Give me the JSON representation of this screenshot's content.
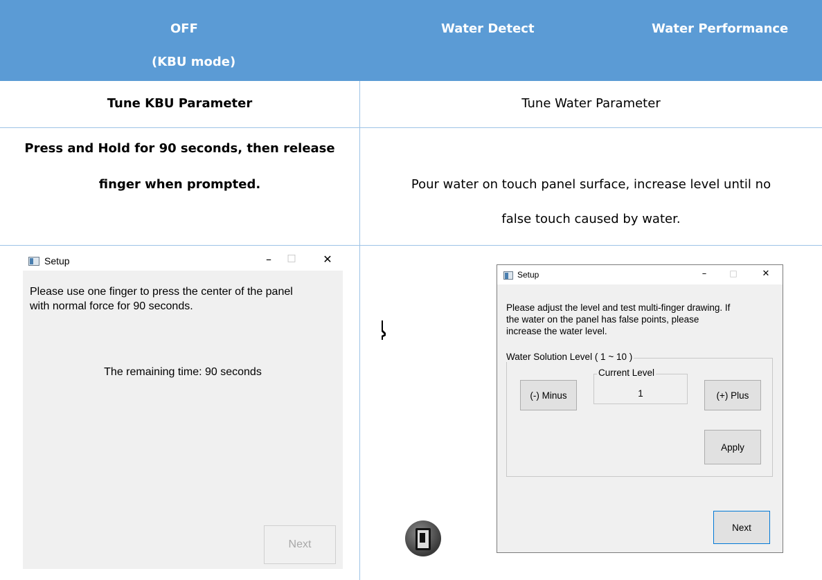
{
  "header": {
    "col1_line1": "OFF",
    "col1_line2": "(KBU mode)",
    "col2": "Water Detect",
    "col3": "Water Performance"
  },
  "row1": {
    "left": "Tune KBU Parameter",
    "right": "Tune Water Parameter"
  },
  "row2": {
    "left_line1": "Press and Hold for 90 seconds, then release",
    "left_line2": "finger when prompted.",
    "right_line1": "Pour water on touch panel surface, increase level until no",
    "right_line2": "false touch caused by water."
  },
  "dialog_kbu": {
    "title": "Setup",
    "message_line1": "Please use one finger to press the center of the panel",
    "message_line2": "with normal force for 90 seconds.",
    "remaining": "The remaining time: 90 seconds",
    "next_label": "Next",
    "minimize": "–",
    "maximize": "□",
    "close": "✕"
  },
  "dialog_water": {
    "title": "Setup",
    "message_line1": "Please adjust the level and test multi-finger drawing. If",
    "message_line2": "the water on the panel has false points, please",
    "message_line3": "increase the water level.",
    "group_label": "Water Solution Level ( 1 ~ 10 )",
    "minus_label": "(-) Minus",
    "current_label": "Current Level",
    "current_value": "1",
    "plus_label": "(+) Plus",
    "apply_label": "Apply",
    "next_label": "Next",
    "minimize": "–",
    "maximize": "□",
    "close": "✕"
  }
}
